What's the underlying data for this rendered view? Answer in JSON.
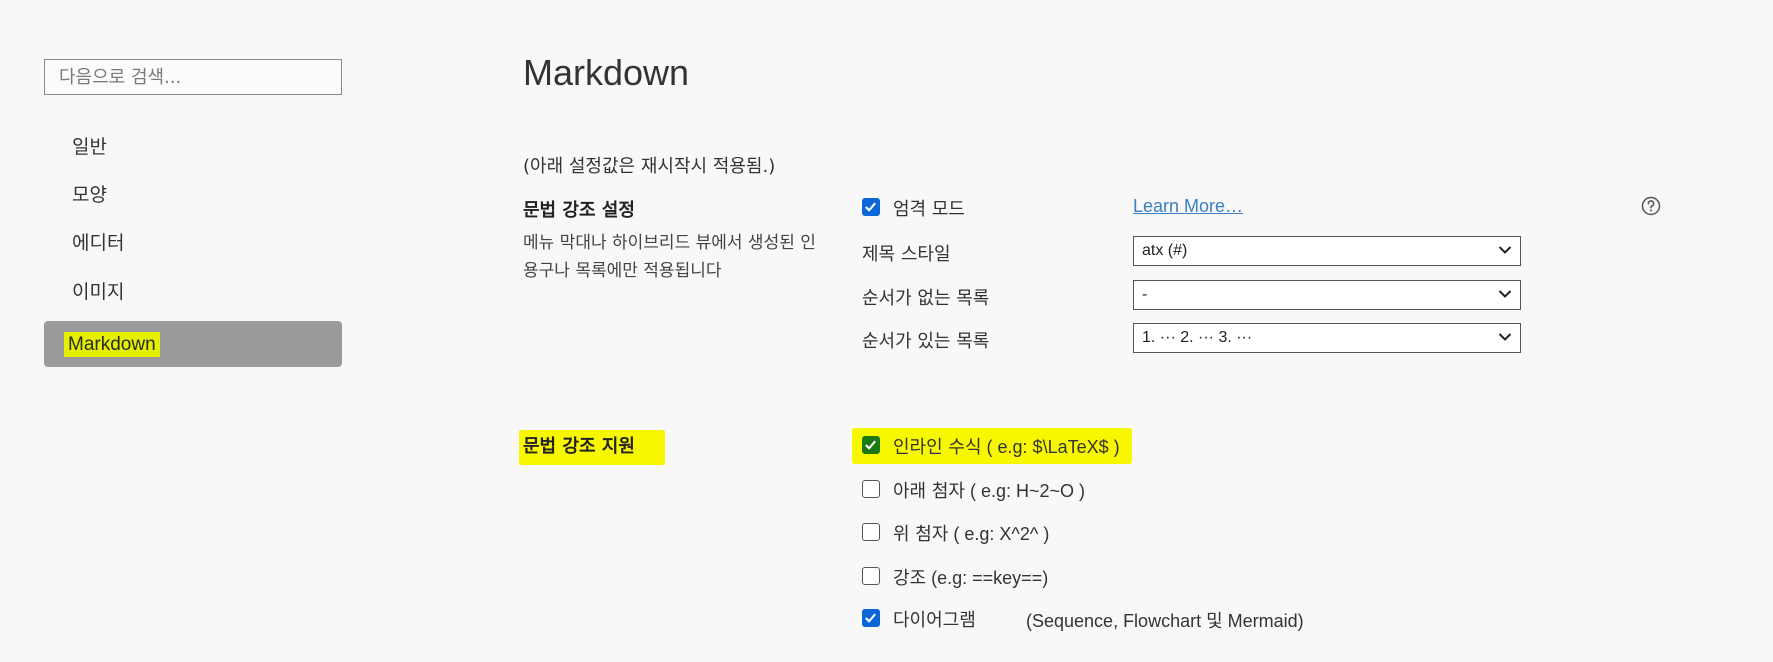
{
  "sidebar": {
    "search_placeholder": "다음으로 검색...",
    "items": [
      {
        "label": "일반"
      },
      {
        "label": "모양"
      },
      {
        "label": "에디터"
      },
      {
        "label": "이미지"
      },
      {
        "label": "Markdown",
        "active": true
      }
    ]
  },
  "main": {
    "title": "Markdown",
    "restart_note": "(아래 설정값은 재시작시 적용됨.)",
    "syntax_settings": {
      "title": "문법 강조 설정",
      "description": "메뉴 막대나 하이브리드 뷰에서 생성된 인용구나 목록에만 적용됩니다",
      "strict_mode": {
        "label": "엄격 모드",
        "checked": true
      },
      "learn_more": "Learn More…",
      "help_icon": "question-circle-icon",
      "heading_style": {
        "label": "제목 스타일",
        "value": "atx (#)"
      },
      "unordered_list": {
        "label": "순서가 없는 목록",
        "value": "-"
      },
      "ordered_list": {
        "label": "순서가 있는 목록",
        "value": "1. ··· 2. ··· 3. ···"
      }
    },
    "syntax_support": {
      "title": "문법 강조 지원",
      "options": [
        {
          "label_ko": "인라인 수식",
          "label_ex": " ( e.g: $\\LaTeX$ )",
          "checked": true
        },
        {
          "label_ko": "아래 첨자",
          "label_ex": " ( e.g: H~2~O )",
          "checked": false
        },
        {
          "label_ko": "위 첨자",
          "label_ex": " ( e.g: X^2^ )",
          "checked": false
        },
        {
          "label_ko": "강조",
          "label_ex": " (e.g: ==key==)",
          "checked": false
        },
        {
          "label_ko": "다이어그램",
          "label_ex": "",
          "checked": true
        }
      ],
      "diagram_note": "(Sequence, Flowchart 및 Mermaid)"
    }
  },
  "colors": {
    "highlight": "#f7f700",
    "checkbox_blue": "#0b66d8",
    "link": "#3b7fc4",
    "active_nav_bg": "#9a9a9a"
  }
}
